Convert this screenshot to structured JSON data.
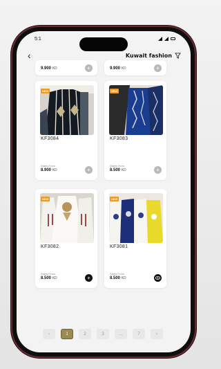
{
  "status": {
    "time": "5:1"
  },
  "header": {
    "brand": "Kuwait fashion"
  },
  "top_cards": [
    {
      "price": "9.900",
      "currency": "KD"
    },
    {
      "price": "9.900",
      "currency": "KD"
    }
  ],
  "products": [
    {
      "badge": "NEW",
      "code": "KF3084",
      "starts_from": "Starts From",
      "price": "8.900",
      "currency": "KD",
      "action": "add"
    },
    {
      "badge": "NEW",
      "code": "KF3083",
      "starts_from": "Starts From",
      "price": "8.500",
      "currency": "KD",
      "action": "add"
    },
    {
      "badge": "NEW",
      "code": "KF3082",
      "starts_from": "Starts From",
      "price": "8.500",
      "currency": "KD",
      "action": "add"
    },
    {
      "badge": "NEW",
      "code": "KF3081",
      "starts_from": "Starts From",
      "price": "8.500",
      "currency": "KD",
      "action": "view"
    }
  ],
  "pagination": {
    "prev_icon": "chevron-left-icon",
    "pages": [
      "1",
      "2",
      "3",
      "...",
      "7"
    ],
    "active": "1",
    "next_icon": "chevron-right-icon"
  },
  "colors": {
    "accent": "#9b8a52",
    "badge": "#f09a1d"
  }
}
